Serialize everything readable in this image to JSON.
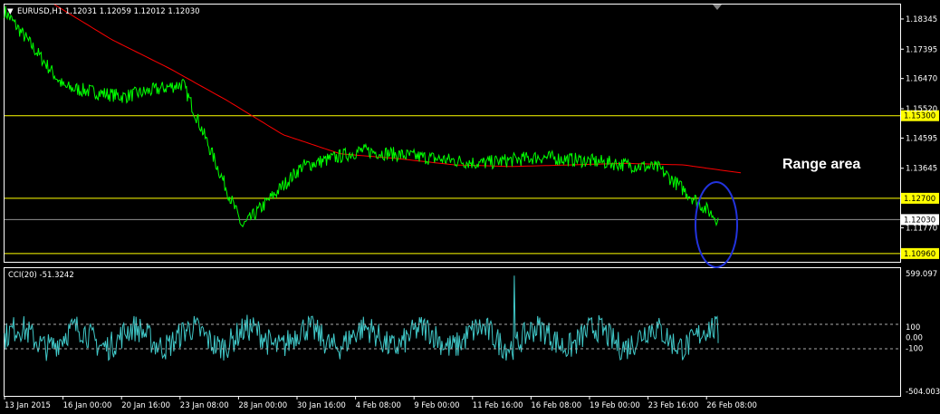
{
  "header": {
    "arrow": "▼",
    "title": "EURUSD,H1  1.12031 1.12059 1.12012 1.12030"
  },
  "indicator": {
    "title": "CCI(20) -51.3242"
  },
  "annotation": {
    "text": "Range area"
  },
  "colors": {
    "background": "#000000",
    "price": "#00ff00",
    "ma": "#ff0000",
    "levels": "#ffff00",
    "cci": "#40c8c8",
    "ellipse": "#1f2fdf",
    "grid": "#ffffff"
  },
  "chart_data": [
    {
      "type": "line",
      "title": "EURUSD,H1  1.12031 1.12059 1.12012 1.12030",
      "x_tick_labels": [
        "13 Jan 2015",
        "16 Jan 00:00",
        "20 Jan 16:00",
        "23 Jan 08:00",
        "28 Jan 00:00",
        "30 Jan 16:00",
        "4 Feb 08:00",
        "9 Feb 00:00",
        "11 Feb 16:00",
        "16 Feb 08:00",
        "19 Feb 00:00",
        "23 Feb 16:00",
        "26 Feb 08:00"
      ],
      "y_tick_labels": [
        "1.18345",
        "1.17395",
        "1.16470",
        "1.15520",
        "1.14595",
        "1.13645",
        "1.12030",
        "1.11770",
        "1.10960"
      ],
      "ylim": [
        1.107,
        1.188
      ],
      "level_lines": [
        {
          "value": 1.153,
          "label": "1.15300"
        },
        {
          "value": 1.127,
          "label": "1.12700"
        },
        {
          "value": 1.1096,
          "label": "1.10960"
        }
      ],
      "current_price": {
        "value": 1.1203,
        "label": "1.12030"
      },
      "series": [
        {
          "name": "EURUSD",
          "x": [
            0,
            1,
            2,
            3,
            4,
            5,
            6,
            7,
            8,
            9,
            10,
            11,
            12
          ],
          "values": [
            1.186,
            1.162,
            1.159,
            1.163,
            1.118,
            1.137,
            1.142,
            1.14,
            1.138,
            1.14,
            1.1385,
            1.1365,
            1.1203
          ]
        },
        {
          "x": [
            0,
            1,
            2,
            3,
            4,
            5,
            6,
            7,
            8,
            9,
            10,
            11,
            12
          ],
          "values": [
            1.188,
            1.177,
            1.168,
            1.158,
            1.147,
            1.141,
            1.1395,
            1.1375,
            1.137,
            1.1375,
            1.138,
            1.1375,
            1.135
          ]
        }
      ]
    },
    {
      "type": "line",
      "title": "CCI(20) -51.3242",
      "y_tick_labels": [
        "599.097",
        "100",
        "0.00",
        "-100",
        "-504.003"
      ],
      "ylim": [
        -504.003,
        599.097
      ],
      "level_lines": [
        {
          "value": 100
        },
        {
          "value": -100
        }
      ],
      "series": [
        {
          "name": "CCI(20)",
          "values": [
            -51.3242
          ]
        }
      ]
    }
  ]
}
